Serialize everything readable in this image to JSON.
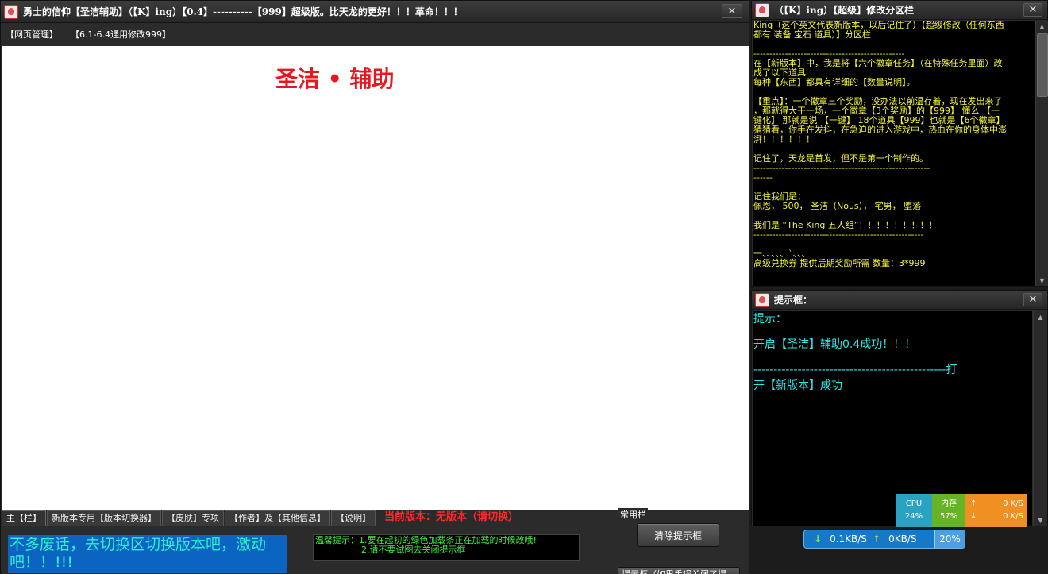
{
  "main_window": {
    "title": "勇士的信仰【圣洁辅助】（【K】ing）【0.4】----------【999】超级版。比天龙的更好！！！革命！！！",
    "close": "✕",
    "menu": [
      "【网页管理】",
      "【6.1-6.4通用修改999】"
    ],
    "headline": "圣洁 • 辅助",
    "bottom_tabs": [
      "主【栏】",
      "新版本专用【版本切换器】",
      "【皮肤】专项",
      "【作者】及【其他信息】",
      "【说明】"
    ],
    "version_hint": "当前版本：无版本（请切换）",
    "group_label": "常用栏",
    "motto": "不多废话，去切换区切换版本吧，激动吧！！!!!",
    "tips": {
      "label": "温馨提示：",
      "line1": "1.要在起初的绿色加载条正在加载的时候改哦!",
      "line2": "2.请不要试图去关闭提示框"
    },
    "clear_button": "清除提示框",
    "option_button": "提示框（如果手误关闭了提"
  },
  "panel_info": {
    "title": "（【K】ing）【超级】修改分区栏",
    "close": "✕",
    "lines": [
      "King（这个英文代表新版本，以后记住了）【超级修改（任何东西",
      "都有 装备 宝石 道具）】分区栏",
      "",
      "------------------------------------------------",
      "在【新版本】中，我是将【六个徽章任务】（在特殊任务里面）改",
      "成了以下道具",
      "每种【东西】都具有详细的【数量说明】。",
      "",
      "【重点】：一个徽章三个奖励，没办法以前温存着，现在发出来了",
      "，那就得大干一场，一个徽章【3个奖励】的【999】  懂么  【一",
      "键化】  那就是说 【一键】 18个道具【999】也就是【6个徽章】",
      "猜猜看，你手在发抖，在急迫的进入游戏中，热血在你的身体中澎",
      "湃！！！！！！",
      "",
      "记住了，天龙是首发，但不是第一个制作的。",
      "--------------------------------------------------------",
      "------",
      "",
      "记住我们是：",
      "佩恩， 500， 圣洁（Nous）， 宅男， 堕落",
      "",
      "   我们是    “The King  五人组”！！！！！！！！！",
      "------------------------------------------------------",
      "",
      "一、、、、、`、、、",
      "高级兑换券  提供后期奖励所需 数量：3*999"
    ]
  },
  "panel_hint": {
    "title": "提示框：",
    "close": "✕",
    "lines": [
      "提示：",
      "",
      "开启【圣洁】辅助0.4成功！！！",
      "",
      "------------------------------------------------打",
      "开【新版本】成功"
    ]
  },
  "sysmon": {
    "cpu_label": "CPU",
    "cpu_value": "24%",
    "mem_label": "内存",
    "mem_value": "57%",
    "up_arrow": "↑",
    "down_arrow": "↓",
    "net_up": "0 K/S",
    "net_down": "0 K/S"
  },
  "netbar": {
    "down_arrow": "↓",
    "down_speed": "0.1KB/S",
    "up_arrow": "↑",
    "up_speed": "0KB/S",
    "percent": "20%"
  },
  "colors": {
    "headline": "#e8171d",
    "info_text": "#f3f33a",
    "hint_text": "#29e8e8",
    "motto_bg": "#0b63c2",
    "tip_text": "#3df23d"
  }
}
